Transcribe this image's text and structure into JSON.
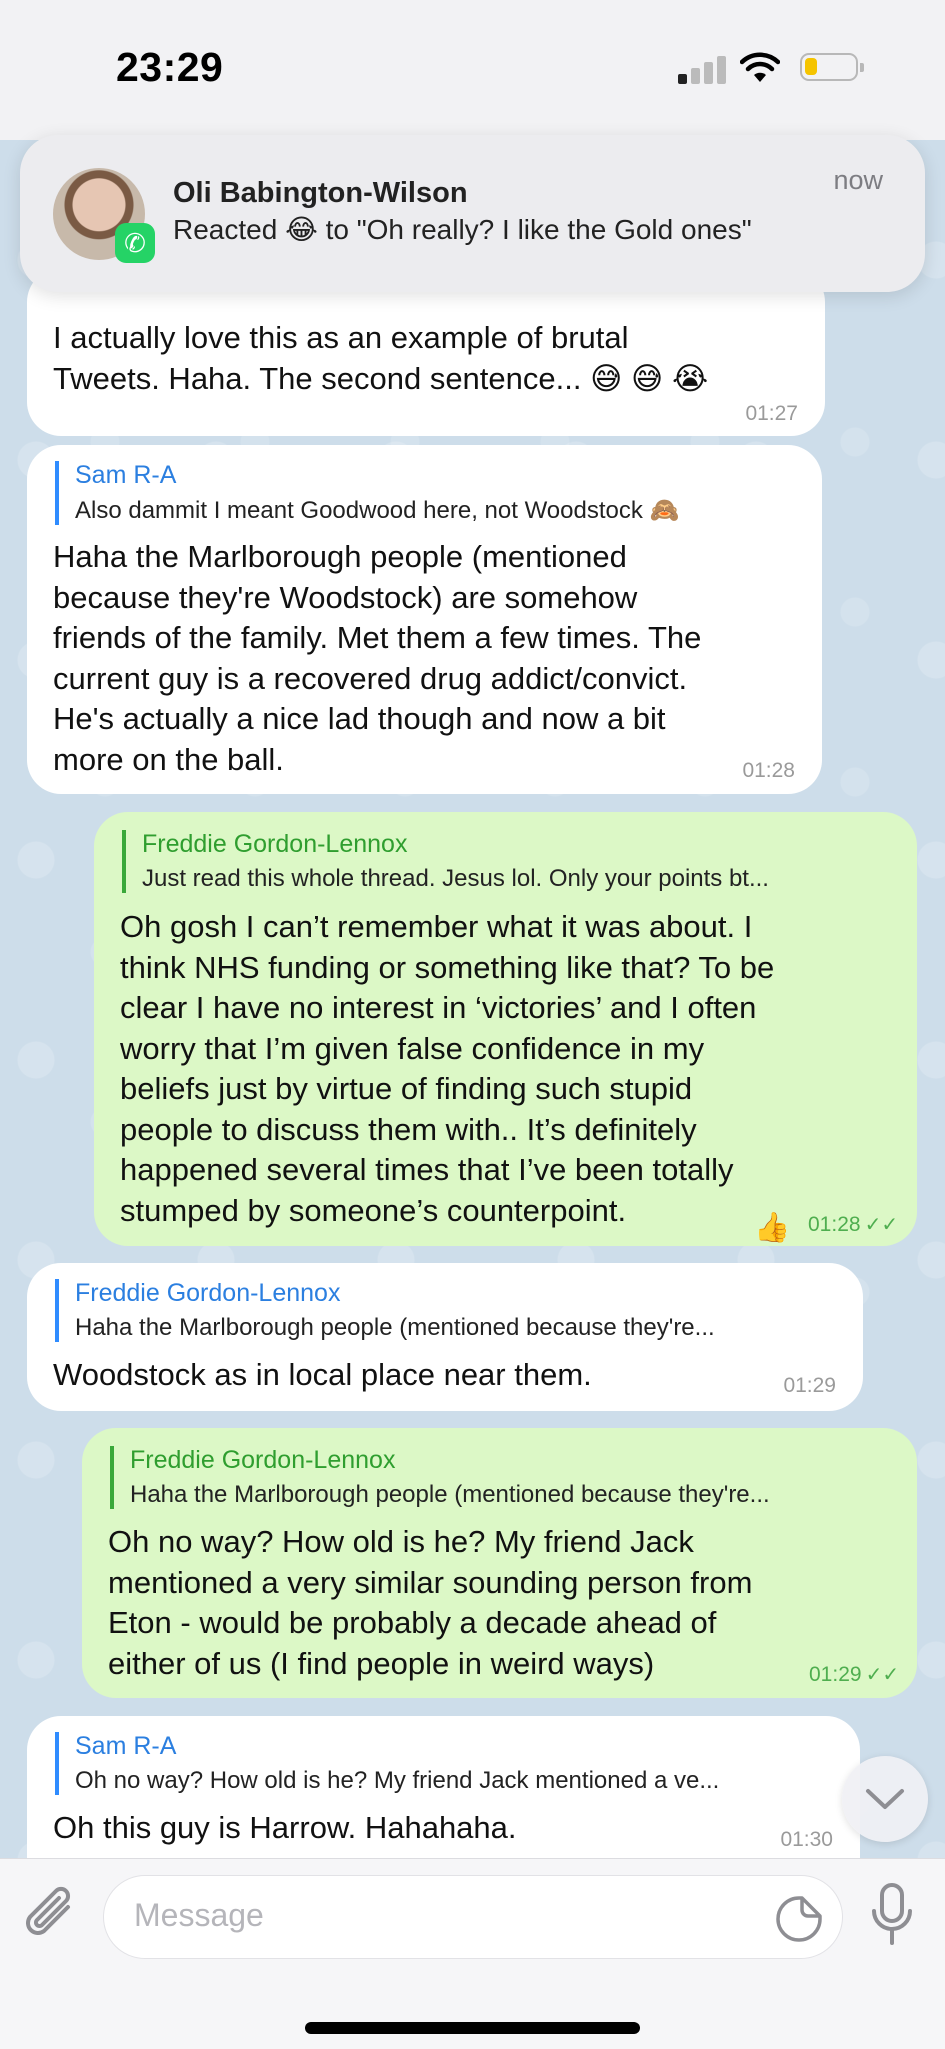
{
  "status_bar": {
    "time": "23:29"
  },
  "notification": {
    "sender": "Oli Babington-Wilson",
    "message": "Reacted 😂 to \"Oh really? I like the Gold ones\"",
    "time": "now"
  },
  "messages": [
    {
      "id": "m1",
      "direction": "incoming",
      "text_lines": [
        "I actually love this as an example of brutal",
        "Tweets. Haha. The second sentence... 😅 😅 😭"
      ],
      "time": "01:27"
    },
    {
      "id": "m2",
      "direction": "incoming",
      "reply_name": "Sam R-A",
      "reply_text": "Also dammit I meant Goodwood here, not Woodstock 🙈",
      "text_lines": [
        "Haha the Marlborough people (mentioned",
        "because they're Woodstock) are somehow",
        "friends of the family. Met them a few times. The",
        "current guy is a recovered drug addict/convict.",
        "He's actually a nice lad though and now a bit",
        "more on the ball."
      ],
      "time": "01:28"
    },
    {
      "id": "m3",
      "direction": "outgoing",
      "reply_name": "Freddie Gordon-Lennox",
      "reply_text": "Just read this whole thread. Jesus lol. Only your points bt...",
      "text_lines": [
        "Oh gosh I can’t remember what it was about. I",
        "think NHS funding or something like that? To be",
        "clear I have no interest in ‘victories’ and I often",
        "worry that I’m given false confidence in my",
        "beliefs just by virtue of finding such stupid",
        "people to discuss them with.. It’s definitely",
        "happened several times that I’ve been totally",
        "stumped by someone’s counterpoint."
      ],
      "reaction": "👍",
      "time": "01:28"
    },
    {
      "id": "m4",
      "direction": "incoming",
      "reply_name": "Freddie Gordon-Lennox",
      "reply_text": "Haha the Marlborough people (mentioned because they're...",
      "text_lines": [
        "Woodstock as in local place near them."
      ],
      "time": "01:29"
    },
    {
      "id": "m5",
      "direction": "outgoing",
      "reply_name": "Freddie Gordon-Lennox",
      "reply_text": "Haha the Marlborough people (mentioned because they're...",
      "text_lines": [
        "Oh no way? How old is he? My friend Jack",
        "mentioned a very similar sounding person from",
        "Eton - would be probably a decade ahead of",
        "either of us (I find people in weird ways)"
      ],
      "time": "01:29"
    },
    {
      "id": "m6",
      "direction": "incoming",
      "reply_name": "Sam R-A",
      "reply_text": "Oh no way? How old is he? My friend Jack mentioned a ve...",
      "text_lines": [
        "Oh this guy is Harrow. Hahahaha."
      ],
      "time": "01:30"
    }
  ],
  "composer": {
    "placeholder": "Message"
  },
  "icons": {
    "attach": "paperclip-icon",
    "sticker": "sticker-icon",
    "mic": "microphone-icon",
    "scroll": "chevron-down-icon",
    "app": "whatsapp-icon"
  },
  "colors": {
    "incoming_bubble": "#ffffff",
    "outgoing_bubble": "#dcf8c6",
    "reply_incoming": "#2b7fe0",
    "reply_outgoing": "#2f9e2f"
  }
}
